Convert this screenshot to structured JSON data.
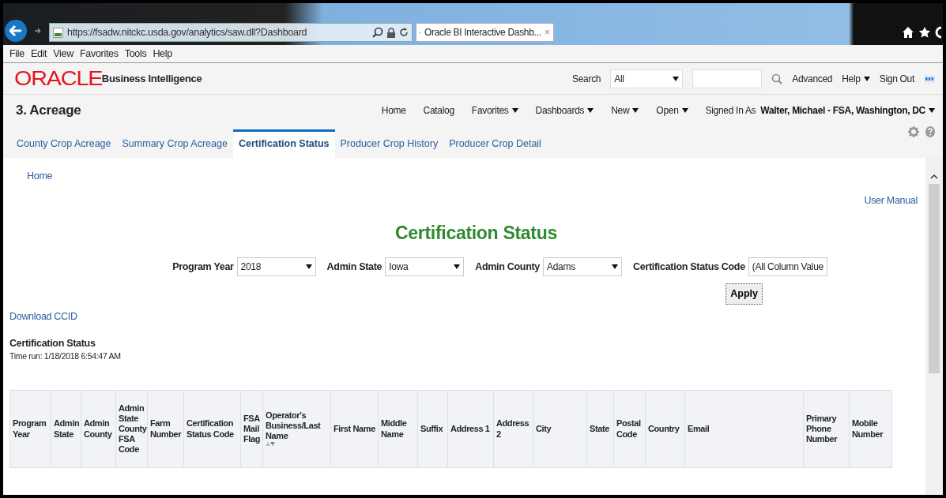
{
  "browser": {
    "url": "https://fsadw.nitckc.usda.gov/analytics/saw.dll?Dashboard",
    "tab_title": "Oracle BI Interactive Dashb...",
    "tab_close": "×"
  },
  "menu_bar": [
    "File",
    "Edit",
    "View",
    "Favorites",
    "Tools",
    "Help"
  ],
  "header": {
    "logo": "ORACLE",
    "product": "Business Intelligence",
    "search_label": "Search",
    "search_scope": "All",
    "links": [
      {
        "label": "Advanced",
        "dropdown": false
      },
      {
        "label": "Help",
        "dropdown": true
      },
      {
        "label": "Sign Out",
        "dropdown": false
      }
    ]
  },
  "dashboard": {
    "title": "3. Acreage",
    "nav": [
      {
        "label": "Home",
        "dropdown": false
      },
      {
        "label": "Catalog",
        "dropdown": false
      },
      {
        "label": "Favorites",
        "dropdown": true
      },
      {
        "label": "Dashboards",
        "dropdown": true
      },
      {
        "label": "New",
        "dropdown": true
      },
      {
        "label": "Open",
        "dropdown": true
      }
    ],
    "signed_in_label": "Signed In As",
    "user": "Walter, Michael - FSA, Washington, DC"
  },
  "tabs": [
    {
      "label": "County Crop Acreage",
      "selected": false
    },
    {
      "label": "Summary Crop Acreage",
      "selected": false
    },
    {
      "label": "Certification Status",
      "selected": true
    },
    {
      "label": "Producer Crop History",
      "selected": false
    },
    {
      "label": "Producer Crop Detail",
      "selected": false
    }
  ],
  "page": {
    "breadcrumb": "Home",
    "user_manual": "User Manual",
    "heading": "Certification Status",
    "prompts": [
      {
        "label": "Program Year",
        "value": "2018"
      },
      {
        "label": "Admin State",
        "value": "Iowa"
      },
      {
        "label": "Admin County",
        "value": "Adams"
      },
      {
        "label": "Certification Status Code",
        "value": "(All Column Value"
      }
    ],
    "apply": "Apply",
    "download": "Download CCID",
    "report_title": "Certification Status",
    "time_run": "Time run: 1/18/2018 6:54:47 AM"
  },
  "table": {
    "columns": [
      {
        "label": "Program Year",
        "sortable": false
      },
      {
        "label": "Admin State",
        "sortable": false
      },
      {
        "label": "Admin County",
        "sortable": false
      },
      {
        "label": "Admin State County FSA Code",
        "sortable": false
      },
      {
        "label": "Farm Number",
        "sortable": false
      },
      {
        "label": "Certification Status Code",
        "sortable": false
      },
      {
        "label": "FSA Mail Flag",
        "sortable": false
      },
      {
        "label": "Operator's Business/Last Name",
        "sortable": true
      },
      {
        "label": "First Name",
        "sortable": false
      },
      {
        "label": "Middle Name",
        "sortable": false
      },
      {
        "label": "Suffix",
        "sortable": false
      },
      {
        "label": "Address 1",
        "sortable": false
      },
      {
        "label": "Address 2",
        "sortable": false
      },
      {
        "label": "City",
        "sortable": false
      },
      {
        "label": "State",
        "sortable": false
      },
      {
        "label": "Postal Code",
        "sortable": false
      },
      {
        "label": "Country",
        "sortable": false
      },
      {
        "label": "Email",
        "sortable": false
      },
      {
        "label": "Primary Phone Number",
        "sortable": false
      },
      {
        "label": "Mobile Number",
        "sortable": false
      }
    ]
  }
}
